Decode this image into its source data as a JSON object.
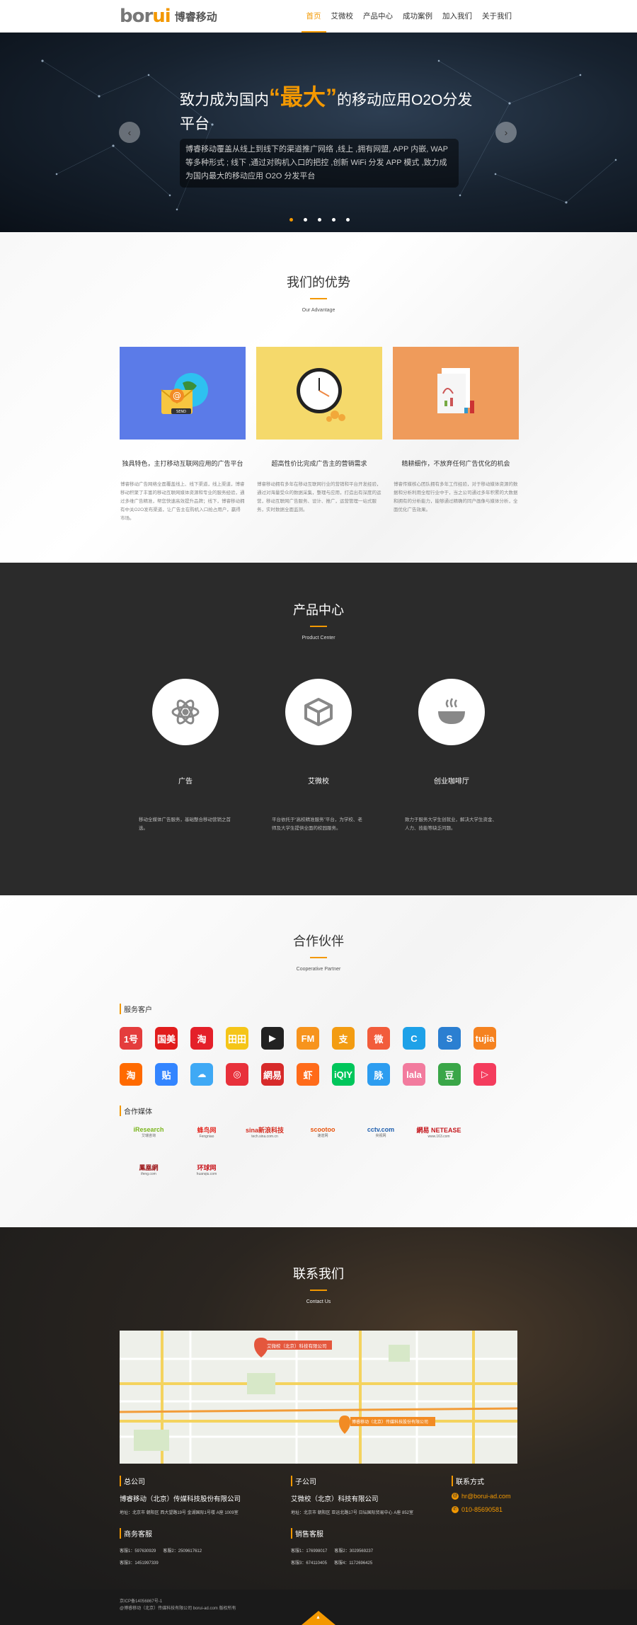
{
  "header": {
    "logo_mark_a": "bor",
    "logo_mark_b": "ui",
    "logo_text": "博睿移动",
    "nav": [
      "首页",
      "艾微校",
      "产品中心",
      "成功案例",
      "加入我们",
      "关于我们"
    ]
  },
  "banner": {
    "title_pre": "致力成为国内",
    "title_big": "“最大”",
    "title_post": "的移动应用O2O分发平台",
    "desc": "博睿移动覆盖从线上到线下的渠道推广网络 ,线上 ,拥有网盟, APP 内嵌, WAP 等多种形式 ; 线下 ,通过对购机入口的把控 ,创新 WiFi 分发 APP 模式 ,致力成为国内最大的移动应用 O2O 分发平台",
    "prev": "‹",
    "next": "›"
  },
  "advantage": {
    "title": "我们的优势",
    "subtitle": "Our Advantage",
    "cards": [
      {
        "caption": "独具特色，主打移动互联网应用的广告平台",
        "text": "博睿移动广告网络全面覆盖线上、线下渠道，线上渠道，博睿移动积聚了丰富的移动互联网媒体资源和专业的服务经验，通过多维广告精准，帮您快速高效提升品牌；线下，博睿移动拥有中关O2O发布渠道，让广告主在购机入口抢占用户，赢得市场。",
        "color": "#5b7be8"
      },
      {
        "caption": "超高性价比完成广告主的营销需求",
        "text": "博睿移动拥有多年在移动互联网行业的营销和平台开发经验，通过对海量受众的数据采集，整理与应用，打造出有深度的运营，移动互联网广告服务、设计、推广，运营管理一站式服务，实时数据全面监测。",
        "color": "#f5d96b"
      },
      {
        "caption": "精耕细作，不放弃任何广告优化的机会",
        "text": "博睿传媒核心团队拥有多年工作经验，对于移动媒体资源的数据和分析利用全程行业中于，当之公司通过多年积累的大数据和拥有的分析能力，能够通过精确的同户画像与媒体分析，全面优化广告效果。",
        "color": "#ef9b5b"
      }
    ]
  },
  "products": {
    "title": "产品中心",
    "subtitle": "Product Center",
    "items": [
      {
        "name": "广告",
        "icon": "atom-icon",
        "desc": "移动全媒体广告服务，基础整合移动营销之首选。"
      },
      {
        "name": "艾微校",
        "icon": "box-icon",
        "desc": "平台依托于“高校精准服务”平台，为学校、老师及大学生提供全面的校园服务。"
      },
      {
        "name": "创业咖啡厅",
        "icon": "coffee-icon",
        "desc": "致力于服务大学生创就业，解决大学生资金、人力、技能等缺乏问题。"
      }
    ]
  },
  "partners": {
    "title": "合作伙伴",
    "subtitle": "Cooperative Partner",
    "clients_label": "服务客户",
    "media_label": "合作媒体",
    "clients_row1": [
      {
        "t": "1号",
        "c": "#e43d3d"
      },
      {
        "t": "国美",
        "c": "#e11d1d"
      },
      {
        "t": "淘",
        "c": "#e4202a"
      },
      {
        "t": "田田",
        "c": "#f5c518"
      },
      {
        "t": "▶",
        "c": "#222"
      },
      {
        "t": "FM",
        "c": "#f7941d"
      },
      {
        "t": "支",
        "c": "#f39c12"
      },
      {
        "t": "微",
        "c": "#f25c3b"
      },
      {
        "t": "C",
        "c": "#1ea1e8"
      },
      {
        "t": "S",
        "c": "#2b7fd1"
      },
      {
        "t": "tujia",
        "c": "#f58220"
      }
    ],
    "clients_row2": [
      {
        "t": "淘",
        "c": "#ff6a00"
      },
      {
        "t": "贴",
        "c": "#3385ff"
      },
      {
        "t": "☁",
        "c": "#3fa9f5"
      },
      {
        "t": "◎",
        "c": "#e8313b"
      },
      {
        "t": "網易",
        "c": "#d72a2a"
      },
      {
        "t": "虾",
        "c": "#ff6b1a"
      },
      {
        "t": "iQIY",
        "c": "#00c65b"
      },
      {
        "t": "脉",
        "c": "#2d9df0"
      },
      {
        "t": "lala",
        "c": "#f27b9e"
      },
      {
        "t": "豆",
        "c": "#3aa648"
      },
      {
        "t": "▷",
        "c": "#f43c5d"
      }
    ],
    "media": [
      {
        "name": "iResearch",
        "sub": "艾瑞咨询",
        "color": "#7ab51d"
      },
      {
        "name": "蜂鸟网",
        "sub": "Fengniao",
        "color": "#e4322b"
      },
      {
        "name": "sina新浪科技",
        "sub": "tech.sina.com.cn",
        "color": "#d52b1e"
      },
      {
        "name": "scootoo",
        "sub": "速途网",
        "color": "#e8540d"
      },
      {
        "name": "cctv.com",
        "sub": "央视网",
        "color": "#1f5fae"
      },
      {
        "name": "網易 NETEASE",
        "sub": "www.163.com",
        "color": "#c4161c"
      },
      {
        "name": "鳳凰網",
        "sub": "ifeng.com",
        "color": "#9f1d20"
      },
      {
        "name": "环球网",
        "sub": "huanqiu.com",
        "color": "#c8161d"
      }
    ]
  },
  "contact": {
    "title": "联系我们",
    "subtitle": "Contact Us",
    "map_pin1": "艾微校（北京）科技有限公司",
    "map_pin2": "博睿移动（北京）传媒科技股份有限公司",
    "hq_label": "总公司",
    "hq_name": "博睿移动（北京）传媒科技股份有限公司",
    "hq_addr": "地址：北京市 朝阳区 西大望路19号 金湖国际1号楼 A座 1009室",
    "sub_label": "子公司",
    "sub_name": "艾微校（北京）科技有限公司",
    "sub_addr": "地址：北京市 朝阳区 亚运北路17号 日坛国际贸易中心 A座 852室",
    "way_label": "联系方式",
    "email": "hr@borui-ad.com",
    "phone": "010-85690581",
    "biz_label": "商务客服",
    "biz_qq1": "客服1：597630929",
    "biz_qq2": "客服2：2509617612",
    "biz_qq3": "客服3：1451997339",
    "sales_label": "销售客服",
    "sales_qq1": "客服1：176998017",
    "sales_qq2": "客服2：3029569237",
    "sales_qq3": "客服3：674110405",
    "sales_qq4": "客服4：1172696425"
  },
  "footer": {
    "icp": "京ICP备14056867号-1",
    "copy": "@博睿移动（北京）传媒科技有限公司 borui-ad.com 版权所有",
    "top": "▲"
  }
}
